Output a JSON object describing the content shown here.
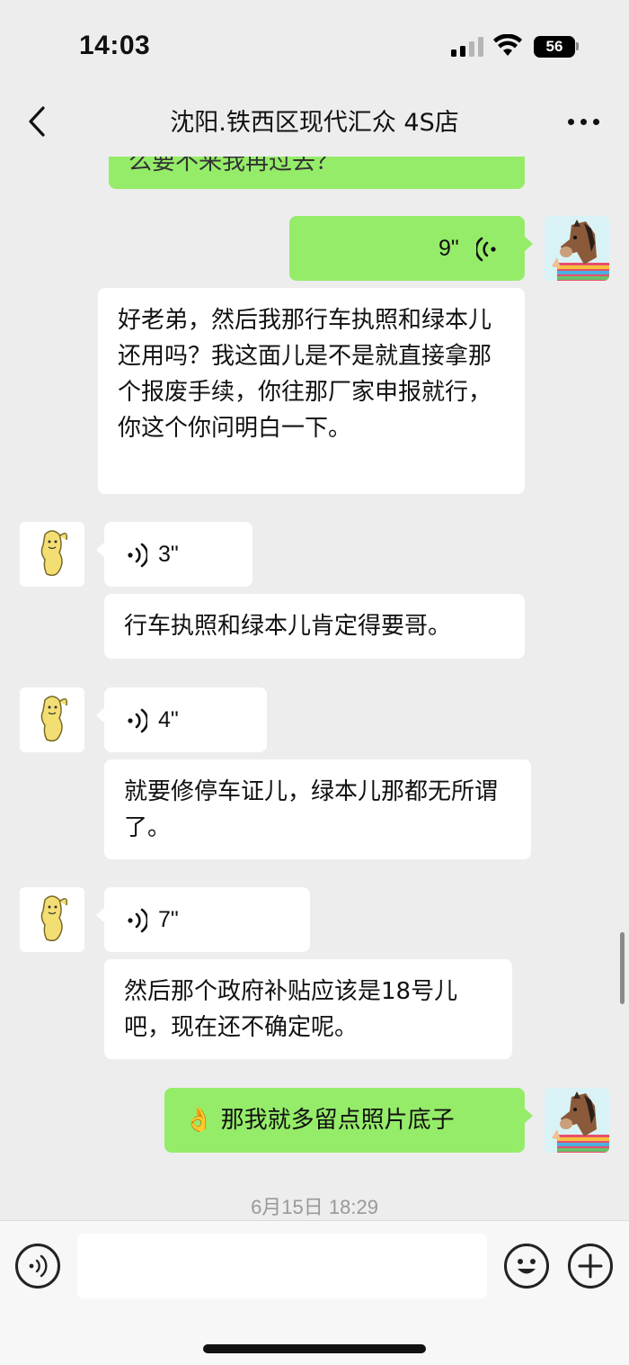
{
  "status_bar": {
    "time": "14:03",
    "battery": "56"
  },
  "header": {
    "title": "沈阳.铁西区现代汇众 4S店"
  },
  "messages": [
    {
      "from": "me",
      "type": "text",
      "text": "么要不来我再过去？"
    },
    {
      "from": "me",
      "type": "voice",
      "duration": "9\""
    },
    {
      "from": "me",
      "type": "text",
      "text": "好老弟，然后我那行车执照和绿本儿还用吗？我这面儿是不是就直接拿那个报废手续，你往那厂家申报就行，你这个你问明白一下。"
    },
    {
      "from": "friend",
      "type": "voice",
      "duration": "3\""
    },
    {
      "from": "friend",
      "type": "text",
      "text": "行车执照和绿本儿肯定得要哥。"
    },
    {
      "from": "friend",
      "type": "voice",
      "duration": "4\""
    },
    {
      "from": "friend",
      "type": "text",
      "text": "就要修停车证儿，绿本儿那都无所谓了。"
    },
    {
      "from": "friend",
      "type": "voice",
      "duration": "7\""
    },
    {
      "from": "friend",
      "type": "text",
      "text": "然后那个政府补贴应该是18号儿吧，现在还不确定呢。"
    },
    {
      "from": "me",
      "type": "text",
      "text": "👌 那我就多留点照片底子"
    }
  ],
  "timestamp": "6月15日 18:29",
  "colors": {
    "bg": "#ededed",
    "green_bubble": "#95ec69",
    "white_bubble": "#ffffff"
  },
  "icons": {
    "back": "chevron-left-icon",
    "more": "more-dots-icon",
    "voice_input": "voice-input-icon",
    "emoji": "emoji-icon",
    "add": "plus-icon"
  }
}
